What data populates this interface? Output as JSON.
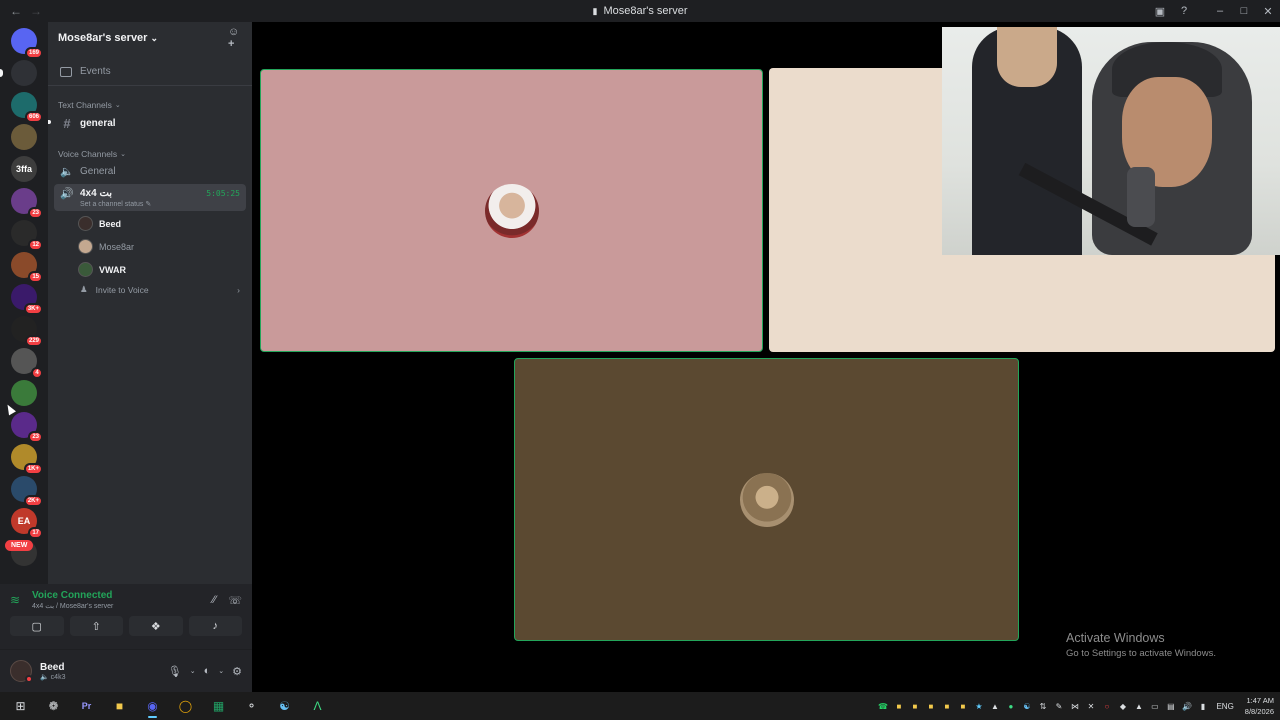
{
  "window": {
    "title": "Mose8ar's server",
    "back_icon": "arrow-left-icon",
    "forward_icon": "arrow-right-icon"
  },
  "guilds": [
    {
      "name": "discord-dm",
      "color": "#5865f2",
      "badge": "169"
    },
    {
      "name": "guild-1",
      "color": "#2f3136",
      "badge": ""
    },
    {
      "name": "guild-2",
      "color": "#1d6b6b",
      "badge": "606"
    },
    {
      "name": "guild-3",
      "color": "#6b5b3a",
      "badge": ""
    },
    {
      "name": "guild-3ffa",
      "color": "#3d3d3d",
      "label": "3ffa",
      "badge": ""
    },
    {
      "name": "guild-5",
      "color": "#6a3d8a",
      "badge": "23"
    },
    {
      "name": "guild-6",
      "color": "#2a2a2a",
      "badge": "12"
    },
    {
      "name": "guild-7",
      "color": "#8a4a2a",
      "badge": "15"
    },
    {
      "name": "guild-8",
      "color": "#3a1a6a",
      "badge": "3K+"
    },
    {
      "name": "guild-9",
      "color": "#222",
      "badge": "229"
    },
    {
      "name": "guild-10",
      "color": "#555",
      "badge": "4"
    },
    {
      "name": "guild-11",
      "color": "#3a7a3a",
      "badge": ""
    },
    {
      "name": "guild-12",
      "color": "#5a2a8a",
      "badge": "23"
    },
    {
      "name": "guild-13",
      "color": "#b08a2a",
      "badge": "1K+"
    },
    {
      "name": "guild-14",
      "color": "#2a4a6a",
      "badge": "2K+"
    },
    {
      "name": "guild-ea",
      "color": "#c0392b",
      "label": "EA",
      "badge": "17"
    },
    {
      "name": "guild-16",
      "color": "#333",
      "badge": ""
    }
  ],
  "new_label": "NEW",
  "sidebar": {
    "server_name": "Mose8ar's server",
    "events_label": "Events",
    "text_category": "Text Channels",
    "text_channel": "general",
    "voice_category": "Voice Channels",
    "voice_channel_general": "General",
    "active_voice": {
      "name": "4x4 بت",
      "timer": "5:05:25",
      "status": "Set a channel status"
    },
    "members": [
      {
        "name": "Beed",
        "style": "bright",
        "color": "#3a2e2c"
      },
      {
        "name": "Mose8ar",
        "style": "dim",
        "color": "#c4a890"
      },
      {
        "name": "VWAR",
        "style": "bright",
        "color": "#3a5a3a"
      }
    ],
    "invite_to_voice": "Invite to Voice"
  },
  "voice_panel": {
    "status": "Voice Connected",
    "location": "4x4 بت / Mose8ar's server"
  },
  "user_panel": {
    "name": "Beed",
    "status": "c4k3"
  },
  "stage": {
    "tile_colors": [
      "#c99a9a",
      "#ebdccc",
      "#5b4931"
    ]
  },
  "watermark": {
    "title": "Activate Windows",
    "subtitle": "Go to Settings to activate Windows."
  },
  "taskbar": {
    "lang": "ENG",
    "time": "1:47 AM",
    "date": "8/8/2026"
  }
}
